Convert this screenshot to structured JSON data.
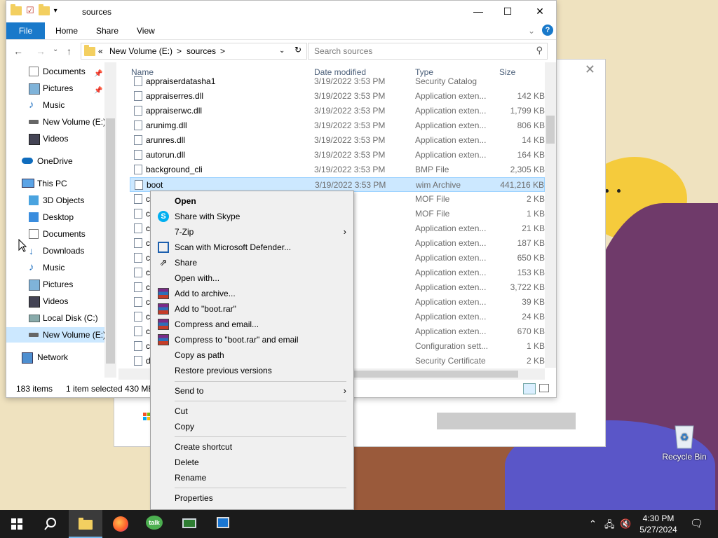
{
  "explorer": {
    "window_title": "sources",
    "controls": {
      "minimize": "—",
      "maximize": "☐",
      "close": "✕"
    },
    "ribbon": {
      "file": "File",
      "home": "Home",
      "share": "Share",
      "view": "View"
    },
    "address": {
      "overflow": "«",
      "volume": "New Volume (E:)",
      "sep1": ">",
      "folder": "sources",
      "sep2": ">"
    },
    "search_placeholder": "Search sources",
    "nav": [
      {
        "label": "Documents",
        "pinned": true
      },
      {
        "label": "Pictures",
        "pinned": true
      },
      {
        "label": "Music"
      },
      {
        "label": "New Volume (E:)"
      },
      {
        "label": "Videos"
      },
      {
        "label": "OneDrive"
      },
      {
        "label": "This PC"
      },
      {
        "label": "3D Objects"
      },
      {
        "label": "Desktop"
      },
      {
        "label": "Documents"
      },
      {
        "label": "Downloads"
      },
      {
        "label": "Music"
      },
      {
        "label": "Pictures"
      },
      {
        "label": "Videos"
      },
      {
        "label": "Local Disk (C:)"
      },
      {
        "label": "New Volume (E:)",
        "selected": true
      },
      {
        "label": "Network"
      }
    ],
    "columns": {
      "name": "Name",
      "date": "Date modified",
      "type": "Type",
      "size": "Size"
    },
    "files": [
      {
        "name": "appraiserdatasha1",
        "date": "3/19/2022 3:53 PM",
        "type": "Security Catalog",
        "size": ""
      },
      {
        "name": "appraiserres.dll",
        "date": "3/19/2022 3:53 PM",
        "type": "Application exten...",
        "size": "142 KB"
      },
      {
        "name": "appraiserwc.dll",
        "date": "3/19/2022 3:53 PM",
        "type": "Application exten...",
        "size": "1,799 KB"
      },
      {
        "name": "arunimg.dll",
        "date": "3/19/2022 3:53 PM",
        "type": "Application exten...",
        "size": "806 KB"
      },
      {
        "name": "arunres.dll",
        "date": "3/19/2022 3:53 PM",
        "type": "Application exten...",
        "size": "14 KB"
      },
      {
        "name": "autorun.dll",
        "date": "3/19/2022 3:53 PM",
        "type": "Application exten...",
        "size": "164 KB"
      },
      {
        "name": "background_cli",
        "date": "3/19/2022 3:53 PM",
        "type": "BMP File",
        "size": "2,305 KB"
      },
      {
        "name": "boot",
        "date": "3/19/2022 3:53 PM",
        "type": "wim Archive",
        "size": "441,216 KB",
        "selected": true
      },
      {
        "name": "c",
        "date": "3:53 PM",
        "type": "MOF File",
        "size": "2 KB"
      },
      {
        "name": "c",
        "date": "3:53 PM",
        "type": "MOF File",
        "size": "1 KB"
      },
      {
        "name": "c",
        "date": "3:53 PM",
        "type": "Application exten...",
        "size": "21 KB"
      },
      {
        "name": "c",
        "date": "3:53 PM",
        "type": "Application exten...",
        "size": "187 KB"
      },
      {
        "name": "c",
        "date": "3:53 PM",
        "type": "Application exten...",
        "size": "650 KB"
      },
      {
        "name": "c",
        "date": "3:53 PM",
        "type": "Application exten...",
        "size": "153 KB"
      },
      {
        "name": "c",
        "date": "3:53 PM",
        "type": "Application exten...",
        "size": "3,722 KB"
      },
      {
        "name": "c",
        "date": "3:53 PM",
        "type": "Application exten...",
        "size": "39 KB"
      },
      {
        "name": "c",
        "date": "3:53 PM",
        "type": "Application exten...",
        "size": "24 KB"
      },
      {
        "name": "c",
        "date": "3:53 PM",
        "type": "Application exten...",
        "size": "670 KB"
      },
      {
        "name": "c",
        "date": "3:53 PM",
        "type": "Configuration sett...",
        "size": "1 KB"
      },
      {
        "name": "d",
        "date": "3:53 PM",
        "type": "Security Certificate",
        "size": "2 KB"
      }
    ],
    "status": {
      "count": "183 items",
      "selected": "1 item selected",
      "size": "430 MB"
    }
  },
  "context_menu": {
    "open": "Open",
    "skype": "Share with Skype",
    "zip": "7-Zip",
    "defender": "Scan with Microsoft Defender...",
    "share": "Share",
    "open_with": "Open with...",
    "add_archive": "Add to archive...",
    "add_rar": "Add to \"boot.rar\"",
    "compress_email": "Compress and email...",
    "compress_rar_email": "Compress to \"boot.rar\" and email",
    "copy_path": "Copy as path",
    "restore": "Restore previous versions",
    "send_to": "Send to",
    "cut": "Cut",
    "copy": "Copy",
    "create_shortcut": "Create shortcut",
    "delete": "Delete",
    "rename": "Rename",
    "properties": "Properties"
  },
  "desktop": {
    "recycle_bin": "Recycle Bin"
  },
  "taskbar": {
    "time": "4:30 PM",
    "date": "5/27/2024"
  }
}
